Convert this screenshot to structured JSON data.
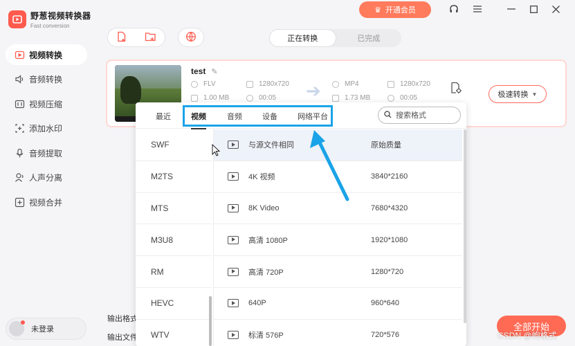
{
  "app": {
    "title": "野葱视频转换器",
    "subtitle": "Fast conversion",
    "brand_color": "#ff5a4e"
  },
  "sidebar": {
    "items": [
      {
        "label": "视频转换",
        "icon": "video-convert-icon",
        "active": true
      },
      {
        "label": "音频转换",
        "icon": "audio-convert-icon"
      },
      {
        "label": "视频压缩",
        "icon": "video-compress-icon"
      },
      {
        "label": "添加水印",
        "icon": "watermark-icon"
      },
      {
        "label": "音频提取",
        "icon": "audio-extract-icon"
      },
      {
        "label": "人声分离",
        "icon": "voice-separate-icon"
      },
      {
        "label": "视频合并",
        "icon": "video-merge-icon"
      }
    ],
    "login_label": "未登录"
  },
  "topbar": {
    "vip_label": "开通会员"
  },
  "segment": {
    "converting": "正在转换",
    "done": "已完成"
  },
  "task": {
    "name": "test",
    "src": {
      "format": "FLV",
      "resolution": "1280x720",
      "size": "1.00 MB",
      "duration": "00:05"
    },
    "dst": {
      "format": "MP4",
      "resolution": "1280x720",
      "size": "1.73 MB",
      "duration": "00:05"
    },
    "speed_label": "极速转换"
  },
  "bottom": {
    "output_format_label": "输出格式",
    "output_file_label": "输出文件",
    "start_all": "全部开始",
    "watermark": "CSDN @岣格式"
  },
  "popup": {
    "tabs": [
      "最近",
      "视频",
      "音频",
      "设备",
      "网络平台"
    ],
    "active_tab": "视频",
    "search_placeholder": "搜索格式",
    "formats": [
      "SWF",
      "M2TS",
      "MTS",
      "M3U8",
      "RM",
      "HEVC",
      "WTV"
    ],
    "resolutions": [
      {
        "name": "与源文件相同",
        "quality": "原始质量"
      },
      {
        "name": "4K 视频",
        "quality": "3840*2160"
      },
      {
        "name": "8K Video",
        "quality": "7680*4320"
      },
      {
        "name": "高清 1080P",
        "quality": "1920*1080"
      },
      {
        "name": "高清 720P",
        "quality": "1280*720"
      },
      {
        "name": "640P",
        "quality": "960*640"
      },
      {
        "name": "标清 576P",
        "quality": "720*576"
      }
    ]
  }
}
